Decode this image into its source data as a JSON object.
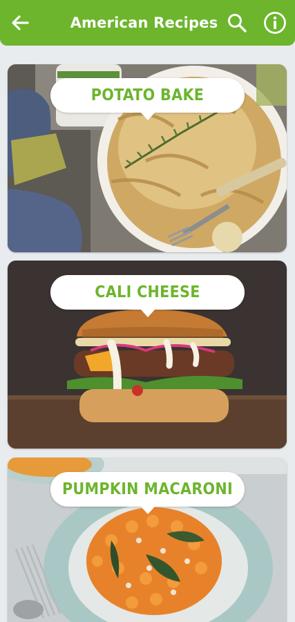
{
  "header": {
    "title": "American Recipes",
    "back_icon": "arrow-left-icon",
    "search_icon": "search-icon",
    "info_icon": "info-icon",
    "background_color": "#6cb52d"
  },
  "recipes": [
    {
      "name": "POTATO BAKE",
      "image": "potato-bake-photo"
    },
    {
      "name": "CALI CHEESE",
      "image": "cheeseburger-photo"
    },
    {
      "name": "PUMPKIN MACARONI",
      "image": "pumpkin-macaroni-photo"
    }
  ],
  "accent_color": "#6cb52d"
}
